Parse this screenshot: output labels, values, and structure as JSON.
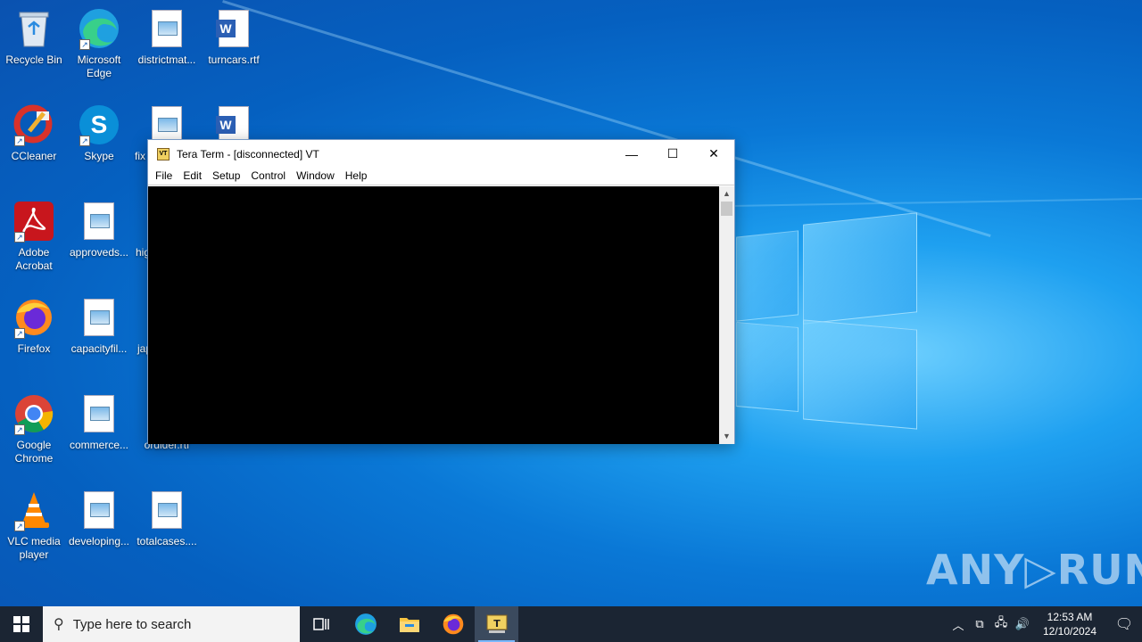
{
  "desktop": {
    "icons": [
      {
        "label": "Recycle Bin"
      },
      {
        "label": "Microsoft Edge"
      },
      {
        "label": "districtmat..."
      },
      {
        "label": "turncars.rtf"
      },
      {
        "label": "CCleaner"
      },
      {
        "label": "Skype"
      },
      {
        "label": "fix"
      },
      {
        "label": "Adobe Acrobat"
      },
      {
        "label": "approveds..."
      },
      {
        "label": "hig"
      },
      {
        "label": "Firefox"
      },
      {
        "label": "capacityfil..."
      },
      {
        "label": "jap"
      },
      {
        "label": "Google Chrome"
      },
      {
        "label": "commerce..."
      },
      {
        "label": "ordider.rtf"
      },
      {
        "label": "VLC media player"
      },
      {
        "label": "developing..."
      },
      {
        "label": "totalcases...."
      }
    ]
  },
  "window": {
    "title": "Tera Term - [disconnected] VT",
    "app_icon": "VT",
    "menu": [
      "File",
      "Edit",
      "Setup",
      "Control",
      "Window",
      "Help"
    ],
    "minimize": "—",
    "maximize": "☐",
    "close": "✕"
  },
  "watermark": "ANY▷RUN",
  "taskbar": {
    "search_placeholder": "Type here to search",
    "clock_time": "12:53 AM",
    "clock_date": "12/10/2024"
  }
}
